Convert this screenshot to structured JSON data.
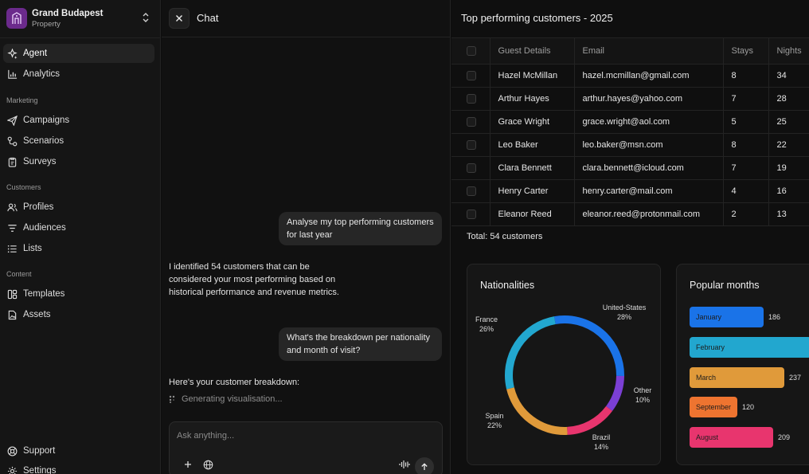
{
  "brand": {
    "name": "Grand Budapest",
    "subtitle": "Property"
  },
  "nav": {
    "agent": "Agent",
    "analytics": "Analytics",
    "marketing_label": "Marketing",
    "campaigns": "Campaigns",
    "scenarios": "Scenarios",
    "surveys": "Surveys",
    "customers_label": "Customers",
    "profiles": "Profiles",
    "audiences": "Audiences",
    "lists": "Lists",
    "content_label": "Content",
    "templates": "Templates",
    "assets": "Assets",
    "support": "Support",
    "settings": "Settings"
  },
  "chat": {
    "title": "Chat",
    "messages": [
      {
        "role": "user",
        "text": "Analyse my top performing customers for last year"
      },
      {
        "role": "agent",
        "text": "I identified 54 customers that can be considered your most performing based on historical performance and revenue metrics."
      },
      {
        "role": "user",
        "text": "What's the breakdown per nationality and month of visit?"
      },
      {
        "role": "agent",
        "text": "Here's your customer breakdown:"
      }
    ],
    "generating": "Generating visualisation...",
    "input_placeholder": "Ask anything..."
  },
  "report": {
    "title": "Top performing customers - 2025",
    "columns": [
      "Guest Details",
      "Email",
      "Stays",
      "Nights"
    ],
    "rows": [
      [
        "Hazel McMillan",
        "hazel.mcmillan@gmail.com",
        "8",
        "34"
      ],
      [
        "Arthur Hayes",
        "arthur.hayes@yahoo.com",
        "7",
        "28"
      ],
      [
        "Grace Wright",
        "grace.wright@aol.com",
        "5",
        "25"
      ],
      [
        "Leo Baker",
        "leo.baker@msn.com",
        "8",
        "22"
      ],
      [
        "Clara Bennett",
        "clara.bennett@icloud.com",
        "7",
        "19"
      ],
      [
        "Henry Carter",
        "henry.carter@mail.com",
        "4",
        "16"
      ],
      [
        "Eleanor Reed",
        "eleanor.reed@protonmail.com",
        "2",
        "13"
      ]
    ],
    "total": "Total: 54 customers"
  },
  "nationalities": {
    "title": "Nationalities",
    "slices": [
      {
        "label": "United-States",
        "pct": "28%",
        "value": 28,
        "color": "#1a73e8"
      },
      {
        "label": "Other",
        "pct": "10%",
        "value": 10,
        "color": "#7b3fd4"
      },
      {
        "label": "Brazil",
        "pct": "14%",
        "value": 14,
        "color": "#e8356e"
      },
      {
        "label": "Spain",
        "pct": "22%",
        "value": 22,
        "color": "#e09a3a"
      },
      {
        "label": "France",
        "pct": "26%",
        "value": 26,
        "color": "#22a7cf"
      }
    ]
  },
  "months": {
    "title": "Popular months",
    "max": 300,
    "bars": [
      {
        "label": "January",
        "value": 186,
        "display": "186",
        "color": "#1a73e8"
      },
      {
        "label": "February",
        "value": 305,
        "display": "",
        "color": "#22a7cf"
      },
      {
        "label": "March",
        "value": 237,
        "display": "237",
        "color": "#e09a3a"
      },
      {
        "label": "September",
        "value": 120,
        "display": "120",
        "color": "#ee7430"
      },
      {
        "label": "August",
        "value": 209,
        "display": "209",
        "color": "#e8356e"
      }
    ]
  }
}
